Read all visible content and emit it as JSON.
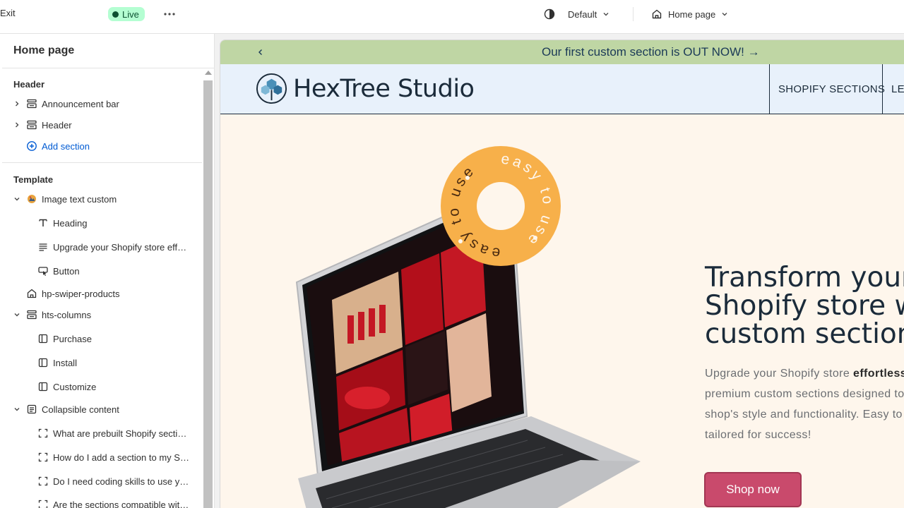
{
  "topbar": {
    "exit_label": "Exit",
    "status_badge": "Live",
    "theme_select": "Default",
    "page_select": "Home page"
  },
  "sidebar": {
    "title": "Home page",
    "groups": {
      "header": "Header",
      "template": "Template"
    },
    "header_items": [
      "Announcement bar",
      "Header"
    ],
    "add_section": "Add section",
    "template_items": [
      "Image text custom",
      "Heading",
      "Upgrade your Shopify store effortlessly with premium custom sections",
      "Button",
      "hp-swiper-products",
      "hts-columns",
      "Purchase",
      "Install",
      "Customize",
      "Collapsible content",
      "What are prebuilt Shopify sections?",
      "How do I add a section to my Shopify store?",
      "Do I need coding skills to use your sections?",
      "Are the sections compatible with my theme?"
    ]
  },
  "preview": {
    "announcement": "Our first custom section is OUT NOW! →",
    "brand": "HexTree Studio",
    "nav": [
      "SHOPIFY SECTIONS",
      "LEARN"
    ],
    "badge_text": "easy to use",
    "hero": {
      "title_lines": [
        "Transform your",
        "Shopify store with",
        "custom sections"
      ],
      "text_before": "Upgrade your Shopify store ",
      "text_bold": "effortlessly",
      "text_lines": [
        "premium custom sections designed to",
        "shop's style and functionality. Easy to",
        "tailored for success!"
      ],
      "button": "Shop now"
    }
  },
  "colors": {
    "live_bg": "#b4fed2",
    "announcement_bg": "#bfd6a4",
    "header_bg": "#e8f1fb",
    "hero_bg": "#fef6ec",
    "badge_orange": "#f7b04a",
    "button_bg": "#c94a6c",
    "link_blue": "#005bd3"
  }
}
